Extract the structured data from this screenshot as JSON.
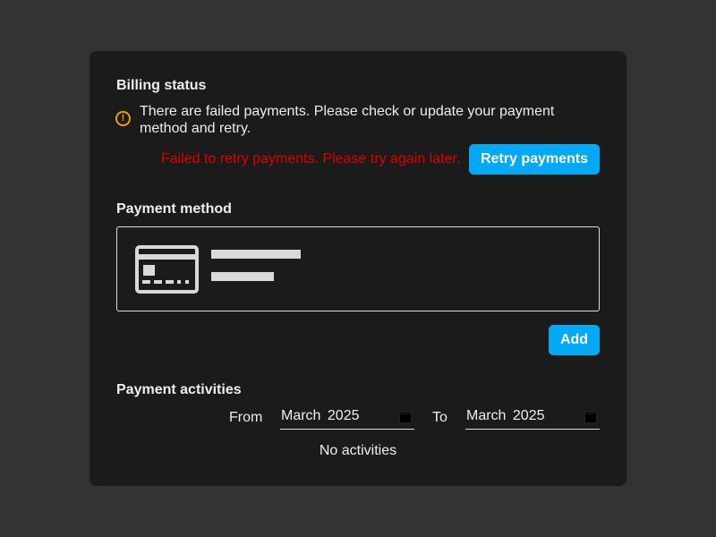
{
  "billing": {
    "title": "Billing status",
    "warning": "There are failed payments. Please check or update your payment method and retry.",
    "error": "Failed to retry payments. Please try again later.",
    "retry_label": "Retry payments",
    "warning_color": "#f39c12",
    "error_color": "#e00000",
    "accent": "#03a9f4"
  },
  "payment_method": {
    "title": "Payment method",
    "add_label": "Add"
  },
  "activities": {
    "title": "Payment activities",
    "from_label": "From",
    "from_value": "March 2025",
    "to_label": "To",
    "to_value": "March 2025",
    "empty": "No activities"
  }
}
